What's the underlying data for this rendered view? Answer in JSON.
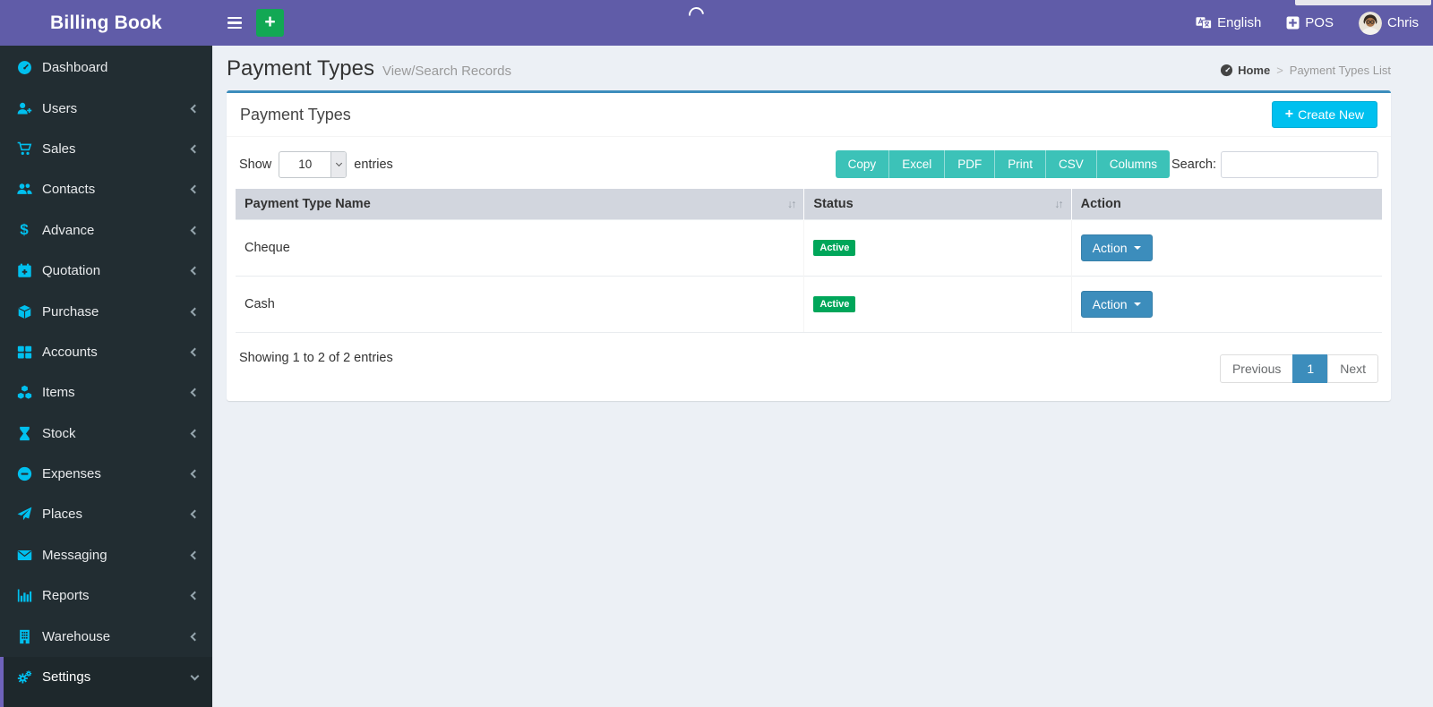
{
  "colors": {
    "topbar": "#605ca8",
    "sidebar-bg": "#222d32",
    "sidebar-active-bg": "#1e282c",
    "content-bg": "#ecf0f5",
    "accent-cyan": "#00c0ef",
    "icon-cyan": "#00c0ef",
    "card-top-border": "#3c8dbc",
    "export-teal": "#3cc2b8",
    "badge-green": "#00a65a",
    "action-blue": "#3c8dbc",
    "green-plus": "#12a854"
  },
  "topbar": {
    "brand": "Billing Book",
    "language_label": "English",
    "pos_label": "POS",
    "user_name": "Chris"
  },
  "sidebar": {
    "items": [
      {
        "label": "Dashboard",
        "icon": "dashboard",
        "chevron": "none"
      },
      {
        "label": "Users",
        "icon": "user-plus",
        "chevron": "left"
      },
      {
        "label": "Sales",
        "icon": "shopping-cart",
        "chevron": "left"
      },
      {
        "label": "Contacts",
        "icon": "users",
        "chevron": "left"
      },
      {
        "label": "Advance",
        "icon": "dollar",
        "chevron": "left"
      },
      {
        "label": "Quotation",
        "icon": "calendar-plus",
        "chevron": "left"
      },
      {
        "label": "Purchase",
        "icon": "cube",
        "chevron": "left"
      },
      {
        "label": "Accounts",
        "icon": "th-large",
        "chevron": "left"
      },
      {
        "label": "Items",
        "icon": "cubes",
        "chevron": "left"
      },
      {
        "label": "Stock",
        "icon": "hourglass",
        "chevron": "left"
      },
      {
        "label": "Expenses",
        "icon": "minus-circle",
        "chevron": "left"
      },
      {
        "label": "Places",
        "icon": "paper-plane",
        "chevron": "left"
      },
      {
        "label": "Messaging",
        "icon": "envelope",
        "chevron": "left"
      },
      {
        "label": "Reports",
        "icon": "bar-chart",
        "chevron": "left"
      },
      {
        "label": "Warehouse",
        "icon": "building",
        "chevron": "left"
      },
      {
        "label": "Settings",
        "icon": "gears",
        "chevron": "down",
        "active": true
      }
    ]
  },
  "page": {
    "title": "Payment Types",
    "subtitle": "View/Search Records",
    "breadcrumb": {
      "home": "Home",
      "separator": ">",
      "current": "Payment Types List"
    }
  },
  "card": {
    "title": "Payment Types",
    "create_button_label": "Create New",
    "length_menu": {
      "show": "Show",
      "value": "10",
      "entries": "entries"
    },
    "export_buttons": [
      "Copy",
      "Excel",
      "PDF",
      "Print",
      "CSV",
      "Columns"
    ],
    "search_label": "Search:",
    "search_value": "",
    "table": {
      "columns": [
        "Payment Type Name",
        "Status",
        "Action"
      ],
      "rows": [
        {
          "name": "Cheque",
          "status": "Active",
          "action": "Action"
        },
        {
          "name": "Cash",
          "status": "Active",
          "action": "Action"
        }
      ]
    },
    "info": "Showing 1 to 2 of 2 entries",
    "pagination": {
      "previous": "Previous",
      "current": "1",
      "next": "Next"
    }
  }
}
